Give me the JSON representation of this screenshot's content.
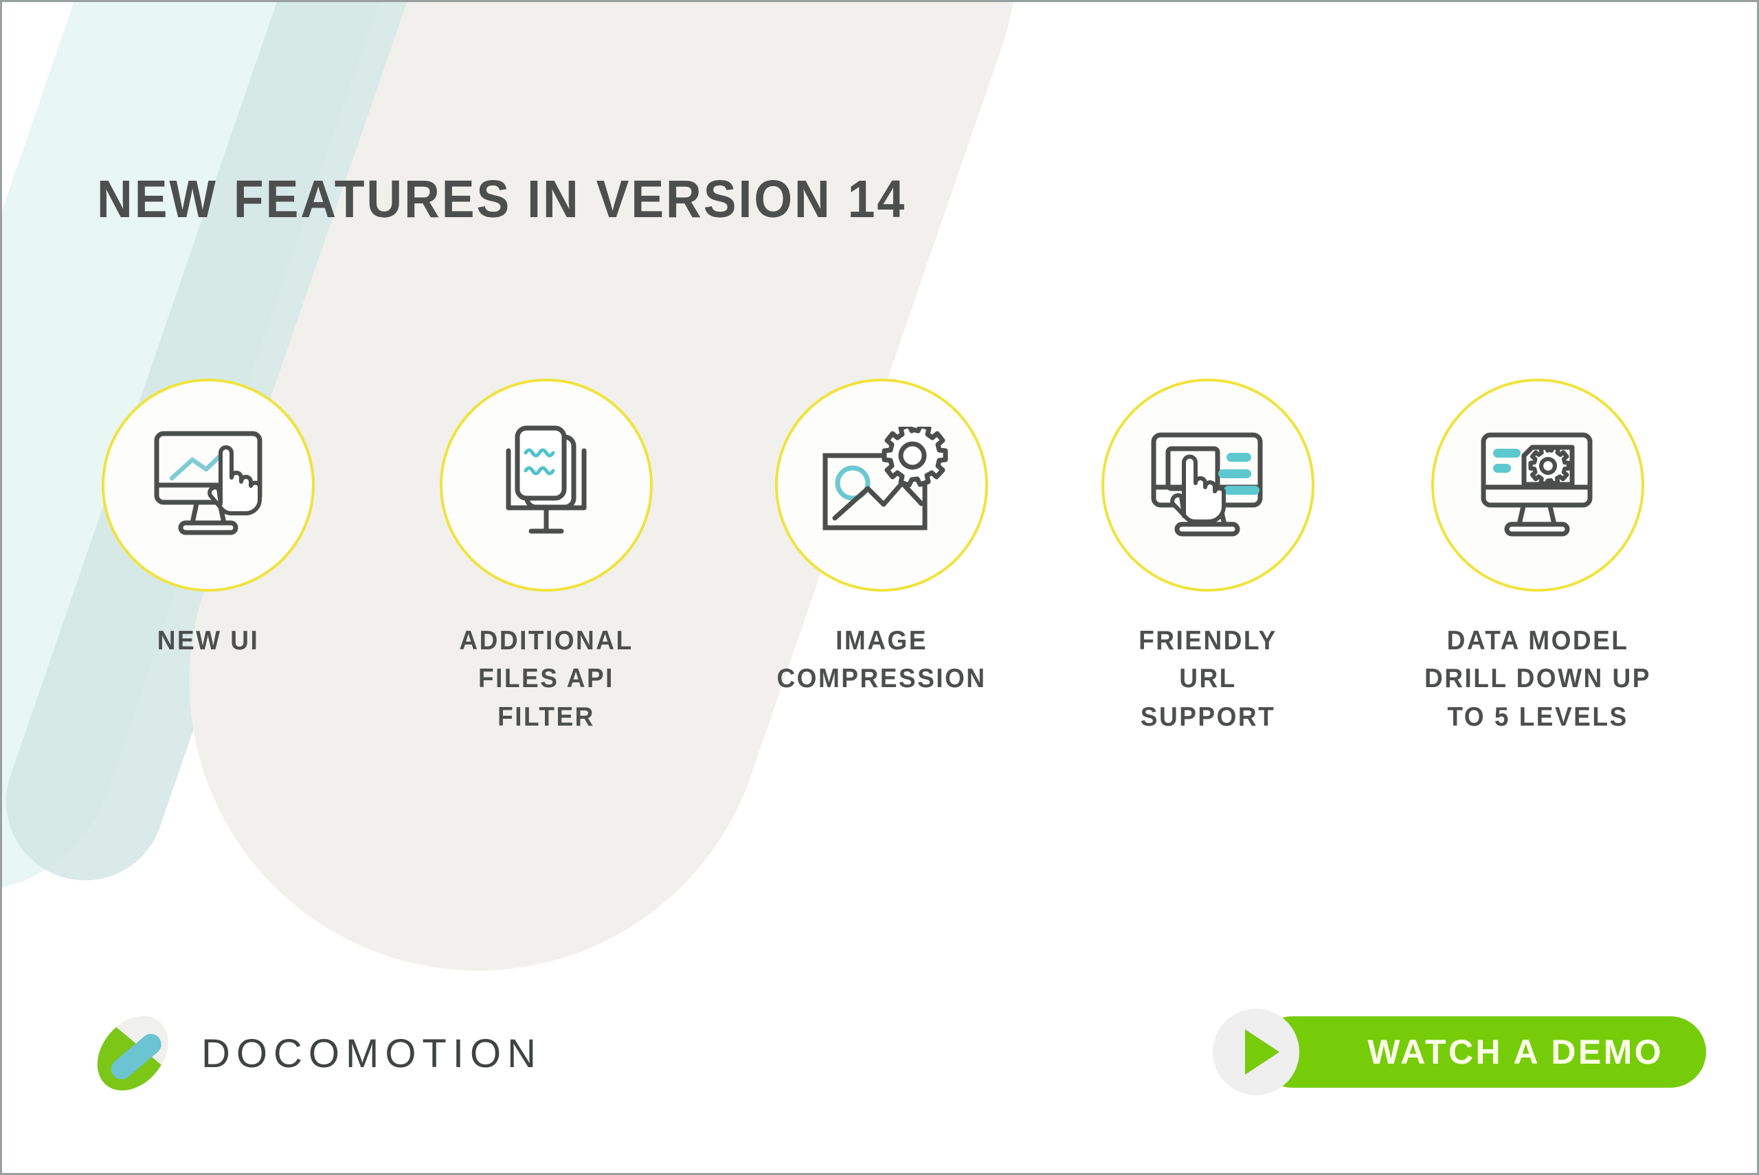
{
  "page": {
    "title": "NEW FEATURES IN VERSION 14",
    "background_color": "#ffffff",
    "border_color": "#9aa0a0"
  },
  "background_bands": [
    {
      "name": "mint-band",
      "color": "#e8f6f4"
    },
    {
      "name": "teal-band",
      "color": "#d4e6e4"
    },
    {
      "name": "beige-band",
      "color": "#f1f0ec"
    }
  ],
  "theme": {
    "ring_color": "#f0e33d",
    "icon_stroke": "#4b4e4c",
    "icon_accent": "#5ec8d0",
    "text_color": "#4c4f4d",
    "brand_green": "#77cc0a",
    "brand_teal": "#6cc3d1"
  },
  "features": [
    {
      "icon": "monitor-chart-pointer-icon",
      "caption": "NEW UI",
      "caption_lines": [
        "NEW UI"
      ]
    },
    {
      "icon": "monitor-documents-icon",
      "caption": "ADDITIONAL FILES API FILTER",
      "caption_lines": [
        "ADDITIONAL",
        "FILES API",
        "FILTER"
      ]
    },
    {
      "icon": "image-gear-icon",
      "caption": "IMAGE COMPRESSION",
      "caption_lines": [
        "IMAGE",
        "COMPRESSION"
      ]
    },
    {
      "icon": "monitor-touch-lines-icon",
      "caption": "FRIENDLY URL SUPPORT",
      "caption_lines": [
        "FRIENDLY",
        "URL",
        "SUPPORT"
      ]
    },
    {
      "icon": "monitor-card-gear-icon",
      "caption": "DATA MODEL DRILL DOWN UP TO 5 LEVELS",
      "caption_lines": [
        "DATA MODEL",
        "DRILL DOWN UP",
        "TO 5 LEVELS"
      ]
    }
  ],
  "logo": {
    "mark": "docomotion-logo-mark",
    "text": "DOCOMOTION"
  },
  "demo_button": {
    "label": "WATCH A DEMO",
    "icon": "play-icon",
    "color": "#77cc0a"
  }
}
